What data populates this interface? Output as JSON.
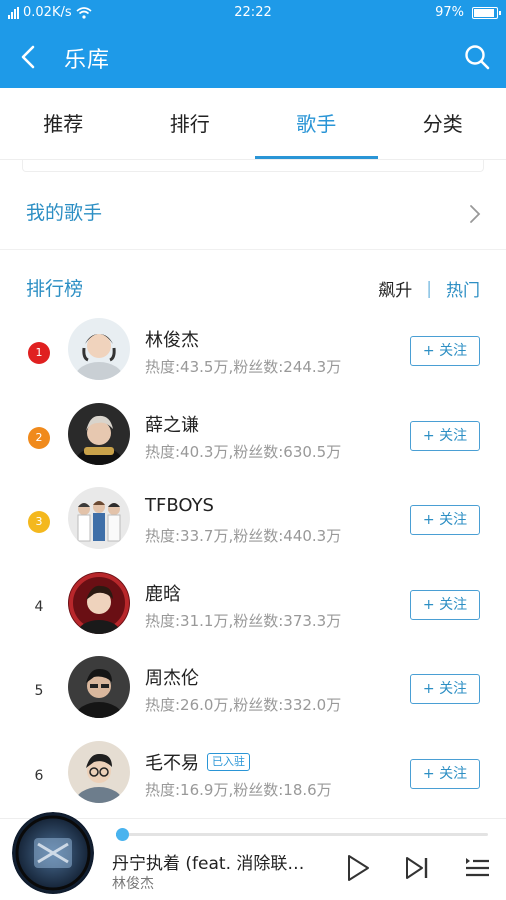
{
  "status": {
    "network_speed": "0.02K/s",
    "time": "22:22",
    "battery": "97%",
    "battery_level": 0.97
  },
  "header": {
    "title": "乐库"
  },
  "tabs": [
    {
      "label": "推荐",
      "active": false
    },
    {
      "label": "排行",
      "active": false
    },
    {
      "label": "歌手",
      "active": true
    },
    {
      "label": "分类",
      "active": false
    }
  ],
  "my_singers": {
    "label": "我的歌手"
  },
  "ranking": {
    "label": "排行榜",
    "switch_rise": "飙升",
    "switch_separator": "|",
    "switch_hot": "热门",
    "follow_label": "+ 关注",
    "singers": [
      {
        "rank": "1",
        "name": "林俊杰",
        "stats": "热度:43.5万,粉丝数:244.3万",
        "badge": "",
        "medal_color": "#e02020"
      },
      {
        "rank": "2",
        "name": "薛之谦",
        "stats": "热度:40.3万,粉丝数:630.5万",
        "badge": "",
        "medal_color": "#f08a1c"
      },
      {
        "rank": "3",
        "name": "TFBOYS",
        "stats": "热度:33.7万,粉丝数:440.3万",
        "badge": "",
        "medal_color": "#f4b81e"
      },
      {
        "rank": "4",
        "name": "鹿晗",
        "stats": "热度:31.1万,粉丝数:373.3万",
        "badge": "",
        "medal_color": ""
      },
      {
        "rank": "5",
        "name": "周杰伦",
        "stats": "热度:26.0万,粉丝数:332.0万",
        "badge": "",
        "medal_color": ""
      },
      {
        "rank": "6",
        "name": "毛不易",
        "stats": "热度:16.9万,粉丝数:18.6万",
        "badge": "已入驻",
        "medal_color": ""
      }
    ]
  },
  "player": {
    "song": "丹宁执着 (feat. 消除联…",
    "artist": "林俊杰",
    "progress": 0.015
  },
  "colors": {
    "header_bg": "#1e9ae8",
    "accent": "#2a95d6"
  }
}
